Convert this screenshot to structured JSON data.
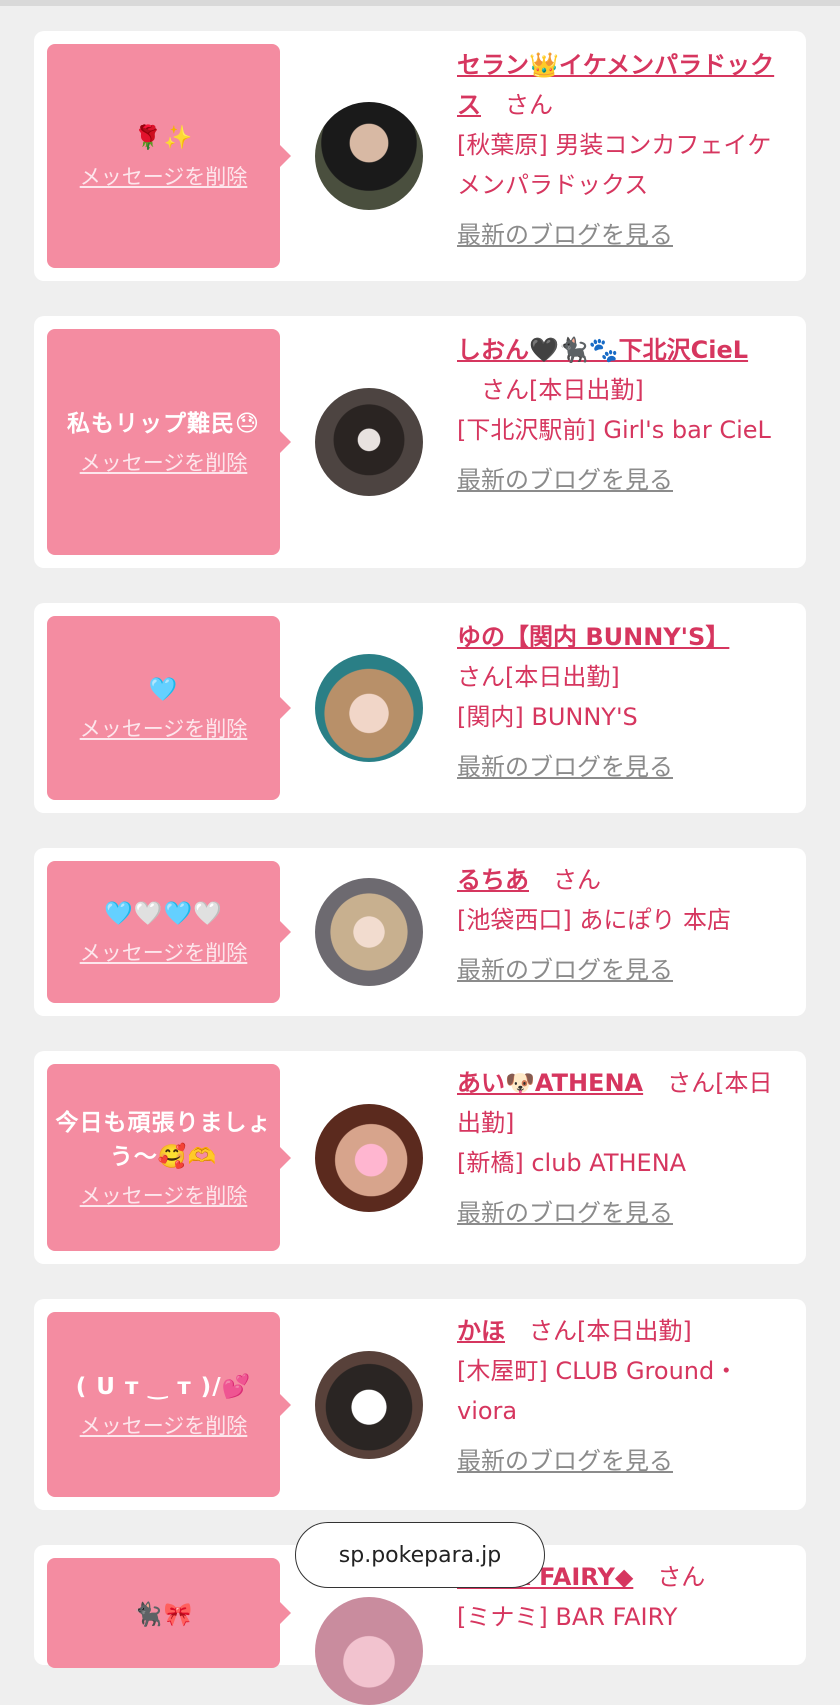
{
  "delete_label": "メッセージを削除",
  "blog_label": "最新のブログを見る",
  "san": "さん",
  "url_bar": "sp.pokepara.jp",
  "items": [
    {
      "message": "🌹✨",
      "name": "セラン👑イケメンパラドックス",
      "status": "",
      "shop": "[秋葉原] 男装コンカフェイケメンパラドックス"
    },
    {
      "message": "私もリップ難民😓",
      "name": "しおん🖤🐈‍⬛🐾下北沢CieL",
      "status": "[本日出勤]",
      "shop": "[下北沢駅前] Girl's bar CieL"
    },
    {
      "message": "🩵",
      "name": "ゆの【関内 BUNNY'S】",
      "status": "[本日出勤]",
      "shop": "[関内] BUNNY'S"
    },
    {
      "message": "🩵🤍🩵🤍",
      "name": "るちあ",
      "status": "",
      "shop": "[池袋西口] あにぽり 本店"
    },
    {
      "message": "今日も頑張りましょう〜🥰🫶",
      "name": "あい🐶ATHENA",
      "status": "[本日出勤]",
      "shop": "[新橋] club ATHENA"
    },
    {
      "message": "( U т ‿ т )/💕",
      "name": "かほ",
      "status": "[本日出勤]",
      "shop": "[木屋町] CLUB Ground・viora"
    },
    {
      "message": "🐈‍⬛🎀",
      "name": "◆BAR FAIRY◆",
      "status": "",
      "shop": "[ミナミ] BAR FAIRY"
    }
  ]
}
